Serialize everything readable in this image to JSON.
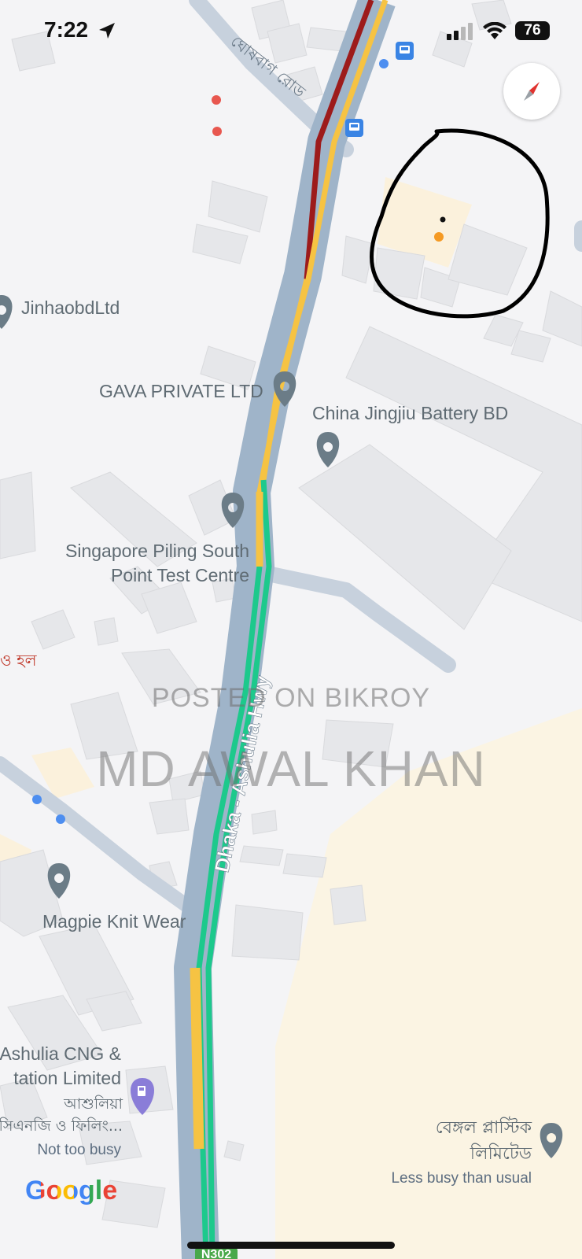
{
  "status_bar": {
    "time": "7:22",
    "battery": "76"
  },
  "map": {
    "roads": {
      "highway_name": "Dhaka - Ashulia Hwy",
      "side_road_name_bn": "ঘোষবাগ রোড",
      "route_shield": "N302"
    },
    "traffic_colors": {
      "heavy": "#9d1b1b",
      "moderate": "#f6c343",
      "free": "#1dc98c",
      "road_casing": "#9fb4c9"
    },
    "places": {
      "jinhaobd": "JinhaobdLtd",
      "gava": "GAVA PRIVATE LTD",
      "china_jingjiu": "China Jingjiu Battery BD",
      "singapore_line1": "Singapore Piling South",
      "singapore_line2": "Point Test Centre",
      "partial_hall_bn": "ও হল",
      "magpie": "Magpie Knit Wear",
      "ashulia_cng_line1": "Ashulia CNG &",
      "ashulia_cng_line2": "tation Limited",
      "ashulia_bn_line1": "আশুলিয়া",
      "ashulia_bn_line2": "সিএনজি ও ফিলিং...",
      "ashulia_busy": "Not too busy",
      "bengal_bn_line1": "বেঙ্গল প্লাস্টিক",
      "bengal_bn_line2": "লিমিটেড",
      "bengal_busy": "Less busy than usual"
    },
    "watermark": {
      "line1": "POSTED ON BIKROY",
      "line2": "MD AWAL KHAN"
    },
    "attribution": "Google",
    "icons": {
      "pin": "place-pin-icon",
      "gas": "gas-station-icon",
      "bus": "bus-stop-icon",
      "compass": "compass-icon",
      "location_arrow": "location-arrow-icon"
    }
  }
}
